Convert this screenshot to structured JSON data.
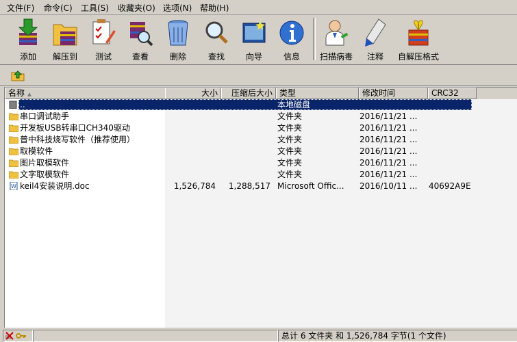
{
  "menu": [
    "文件(F)",
    "命令(C)",
    "工具(S)",
    "收藏夹(O)",
    "选项(N)",
    "帮助(H)"
  ],
  "toolbar": {
    "buttons": [
      {
        "label": "添加",
        "icon": "add-archive-icon"
      },
      {
        "label": "解压到",
        "icon": "extract-to-icon"
      },
      {
        "label": "测试",
        "icon": "test-icon"
      },
      {
        "label": "查看",
        "icon": "view-icon"
      },
      {
        "label": "删除",
        "icon": "delete-icon"
      },
      {
        "label": "查找",
        "icon": "find-icon"
      },
      {
        "label": "向导",
        "icon": "wizard-icon"
      },
      {
        "label": "信息",
        "icon": "info-icon"
      },
      {
        "label": "扫描病毒",
        "icon": "virus-scan-icon"
      },
      {
        "label": "注释",
        "icon": "comment-icon"
      },
      {
        "label": "自解压格式",
        "icon": "sfx-icon"
      }
    ]
  },
  "columns": {
    "name": "名称",
    "size": "大小",
    "packed": "压缩后大小",
    "type": "类型",
    "modified": "修改时间",
    "crc": "CRC32"
  },
  "files": [
    {
      "name": "..",
      "size": "",
      "packed": "",
      "type": "本地磁盘",
      "modified": "",
      "crc": "",
      "kind": "drive",
      "selected": true
    },
    {
      "name": "串口调试助手",
      "size": "",
      "packed": "",
      "type": "文件夹",
      "modified": "2016/11/21 ...",
      "crc": "",
      "kind": "folder"
    },
    {
      "name": "开发板USB转串口CH340驱动",
      "size": "",
      "packed": "",
      "type": "文件夹",
      "modified": "2016/11/21 ...",
      "crc": "",
      "kind": "folder"
    },
    {
      "name": "普中科技烧写软件（推荐使用）",
      "size": "",
      "packed": "",
      "type": "文件夹",
      "modified": "2016/11/21 ...",
      "crc": "",
      "kind": "folder"
    },
    {
      "name": "取模软件",
      "size": "",
      "packed": "",
      "type": "文件夹",
      "modified": "2016/11/21 ...",
      "crc": "",
      "kind": "folder"
    },
    {
      "name": "图片取模软件",
      "size": "",
      "packed": "",
      "type": "文件夹",
      "modified": "2016/11/21 ...",
      "crc": "",
      "kind": "folder"
    },
    {
      "name": "文字取模软件",
      "size": "",
      "packed": "",
      "type": "文件夹",
      "modified": "2016/11/21 ...",
      "crc": "",
      "kind": "folder"
    },
    {
      "name": "keil4安装说明.doc",
      "size": "1,526,784",
      "packed": "1,288,517",
      "type": "Microsoft Offic...",
      "modified": "2016/10/11 ...",
      "crc": "40692A9E",
      "kind": "doc"
    }
  ],
  "status": {
    "summary": "总计 6 文件夹 和 1,526,784 字节(1 个文件)"
  }
}
